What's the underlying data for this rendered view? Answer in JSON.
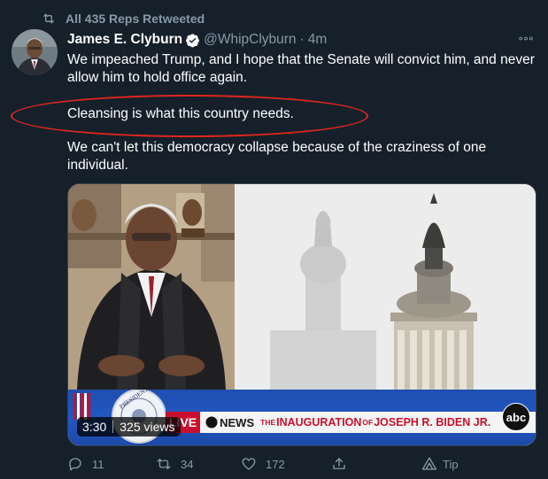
{
  "retweet_context": {
    "icon": "retweet-icon",
    "text": "All 435 Reps Retweeted"
  },
  "author": {
    "name": "James E. Clyburn",
    "handle": "@WhipClyburn",
    "separator": "·",
    "time": "4m",
    "verified_icon": "verified-badge-icon"
  },
  "tweet": {
    "paragraph1": "We impeached Trump, and I hope that the Senate will convict him, and never allow him to hold office again.",
    "paragraph2": "Cleansing is what this country needs.",
    "paragraph3": "We can't let this democracy collapse because of the craziness of one individual."
  },
  "annotation": {
    "ellipse_color": "#e0261e"
  },
  "media": {
    "duration": "3:30",
    "views": "325 views",
    "lower_third": {
      "live": "LIVE",
      "network": "NEWS",
      "the": "THE",
      "inauguration": "INAUGURATION",
      "of": "OF",
      "name": "JOSEPH R. BIDEN JR."
    },
    "seal_text": "PRESIDENT OF THE",
    "network_logo": "abc"
  },
  "actions": {
    "reply_count": "11",
    "retweet_count": "34",
    "like_count": "172",
    "tip_label": "Tip"
  },
  "colors": {
    "background": "#15202b",
    "secondary_text": "#8899a6",
    "verified": "#1da1f2"
  }
}
